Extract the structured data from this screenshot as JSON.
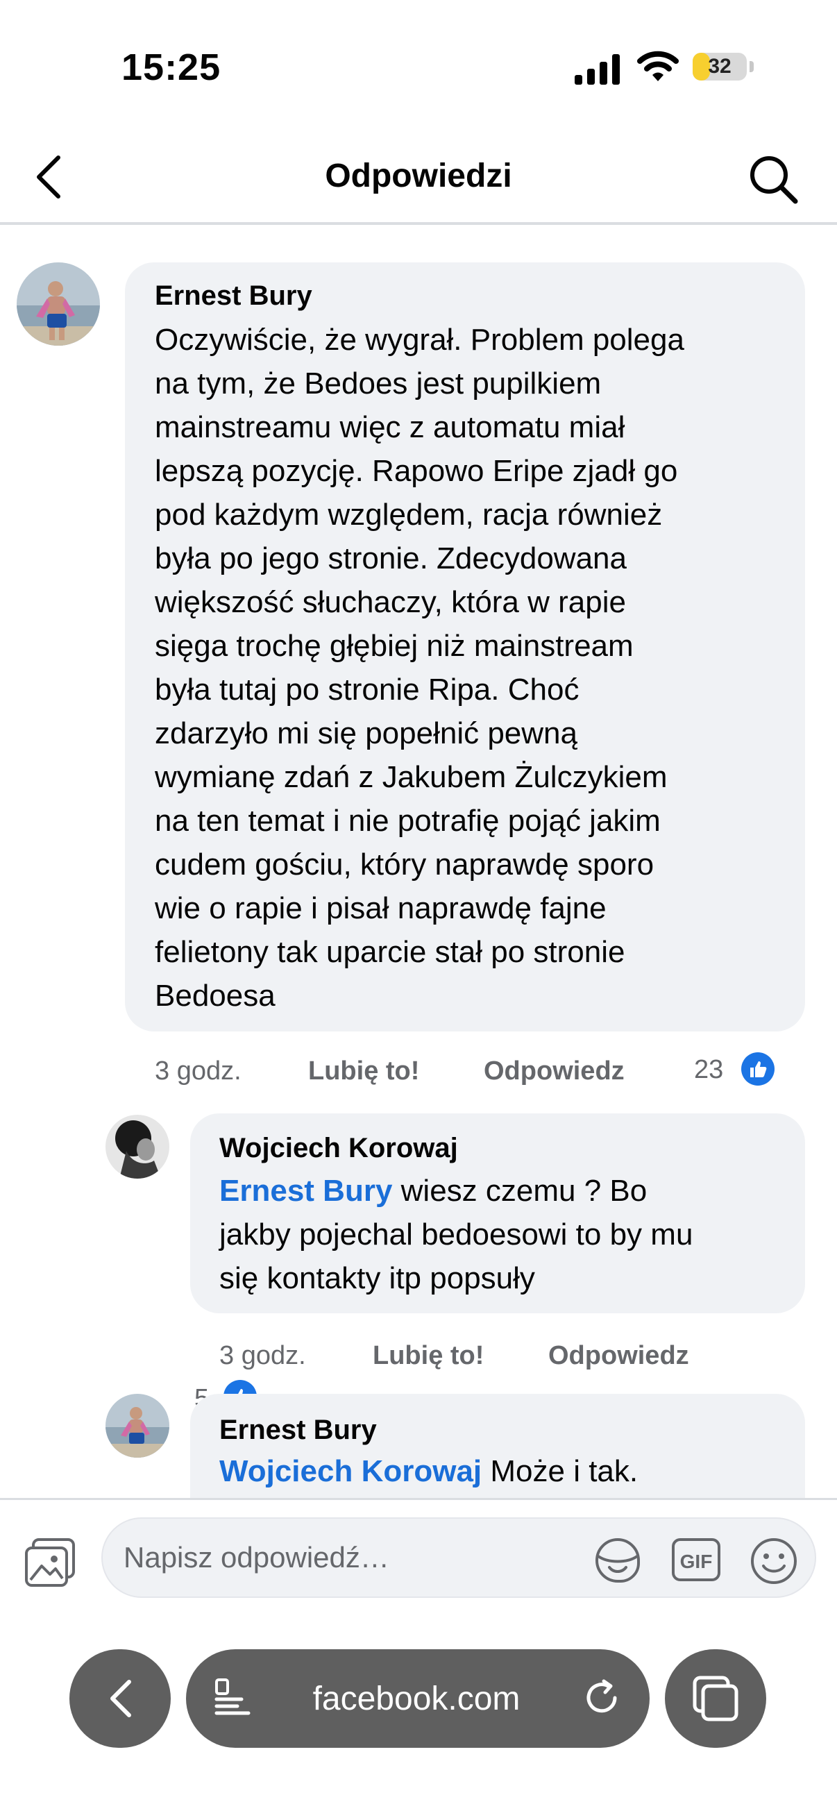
{
  "status_bar": {
    "time": "15:25",
    "battery": "32",
    "battery_level": 0.32
  },
  "header": {
    "title": "Odpowiedzi"
  },
  "comments": [
    {
      "author": "Ernest Bury",
      "text_lines": [
        "Oczywiście, że wygrał. Problem polega",
        "na tym, że Bedoes jest pupilkiem",
        "mainstreamu więc z automatu miał",
        "lepszą pozycję. Rapowo Eripe zjadł go",
        "pod każdym względem, racja również",
        "była po jego stronie. Zdecydowana",
        "większość słuchaczy, która w rapie",
        "sięga trochę głębiej niż mainstream",
        "była tutaj po stronie Ripa. Choć",
        "zdarzyło mi się popełnić pewną",
        "wymianę zdań z Jakubem Żulczykiem",
        "na ten temat i nie potrafię pojąć jakim",
        "cudem gościu, który naprawdę sporo",
        "wie o rapie i pisał naprawdę fajne",
        "felietony tak uparcie stał po stronie",
        "Bedoesa"
      ],
      "time": "3 godz.",
      "like_label": "Lubię to!",
      "reply_label": "Odpowiedz",
      "reactions": "23"
    },
    {
      "author": "Wojciech Korowaj",
      "mention": "Ernest Bury",
      "text_first": " wiesz czemu ? Bo",
      "text_lines": [
        "jakby pojechal bedoesowi to by mu",
        "się kontakty itp popsuły"
      ],
      "time": "3 godz.",
      "like_label": "Lubię to!",
      "reply_label": "Odpowiedz",
      "reactions": "5"
    },
    {
      "author": "Ernest Bury",
      "mention": "Wojciech Korowaj",
      "text_first": " Może i tak."
    }
  ],
  "composer": {
    "placeholder": "Napisz odpowiedź…",
    "gif_label": "GIF"
  },
  "browser": {
    "url": "facebook.com"
  },
  "colors": {
    "accent": "#1b74e4",
    "mention": "#1a6ed8",
    "bubble": "#f0f2f5",
    "meta": "#65676b"
  }
}
